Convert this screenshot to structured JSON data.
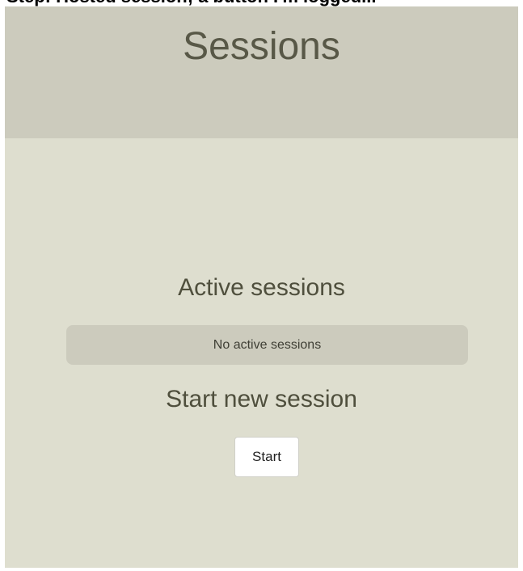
{
  "caption": "Step: Hosted session; a button I'm logged...",
  "header": {
    "title": "Sessions"
  },
  "active": {
    "heading": "Active sessions",
    "empty_message": "No active sessions"
  },
  "new_session": {
    "heading": "Start new session",
    "start_label": "Start"
  },
  "colors": {
    "header_bg": "#cccbbd",
    "page_bg": "#dedecf",
    "title_text": "#585847",
    "button_bg": "#ffffff"
  }
}
